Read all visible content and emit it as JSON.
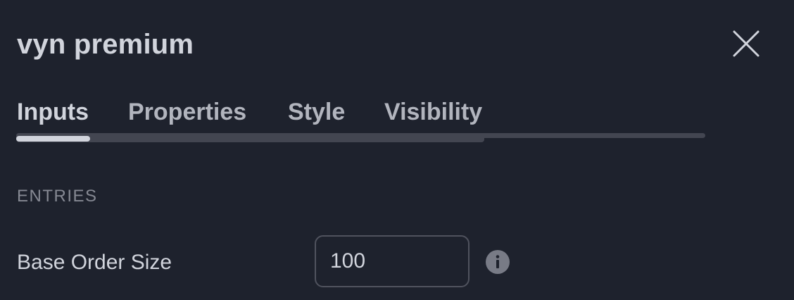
{
  "dialog": {
    "title": "vyn premium",
    "close_icon": "close-icon"
  },
  "tabs": [
    {
      "label": "Inputs",
      "active": true
    },
    {
      "label": "Properties",
      "active": false
    },
    {
      "label": "Style",
      "active": false
    },
    {
      "label": "Visibility",
      "active": false
    }
  ],
  "section": {
    "header": "ENTRIES"
  },
  "fields": [
    {
      "label": "Base Order Size",
      "value": "100",
      "info_icon": "info-icon"
    }
  ],
  "colors": {
    "background": "#1e222d",
    "text": "#d1d4dc",
    "muted": "#868993",
    "border": "#50535e",
    "track": "#434651"
  }
}
